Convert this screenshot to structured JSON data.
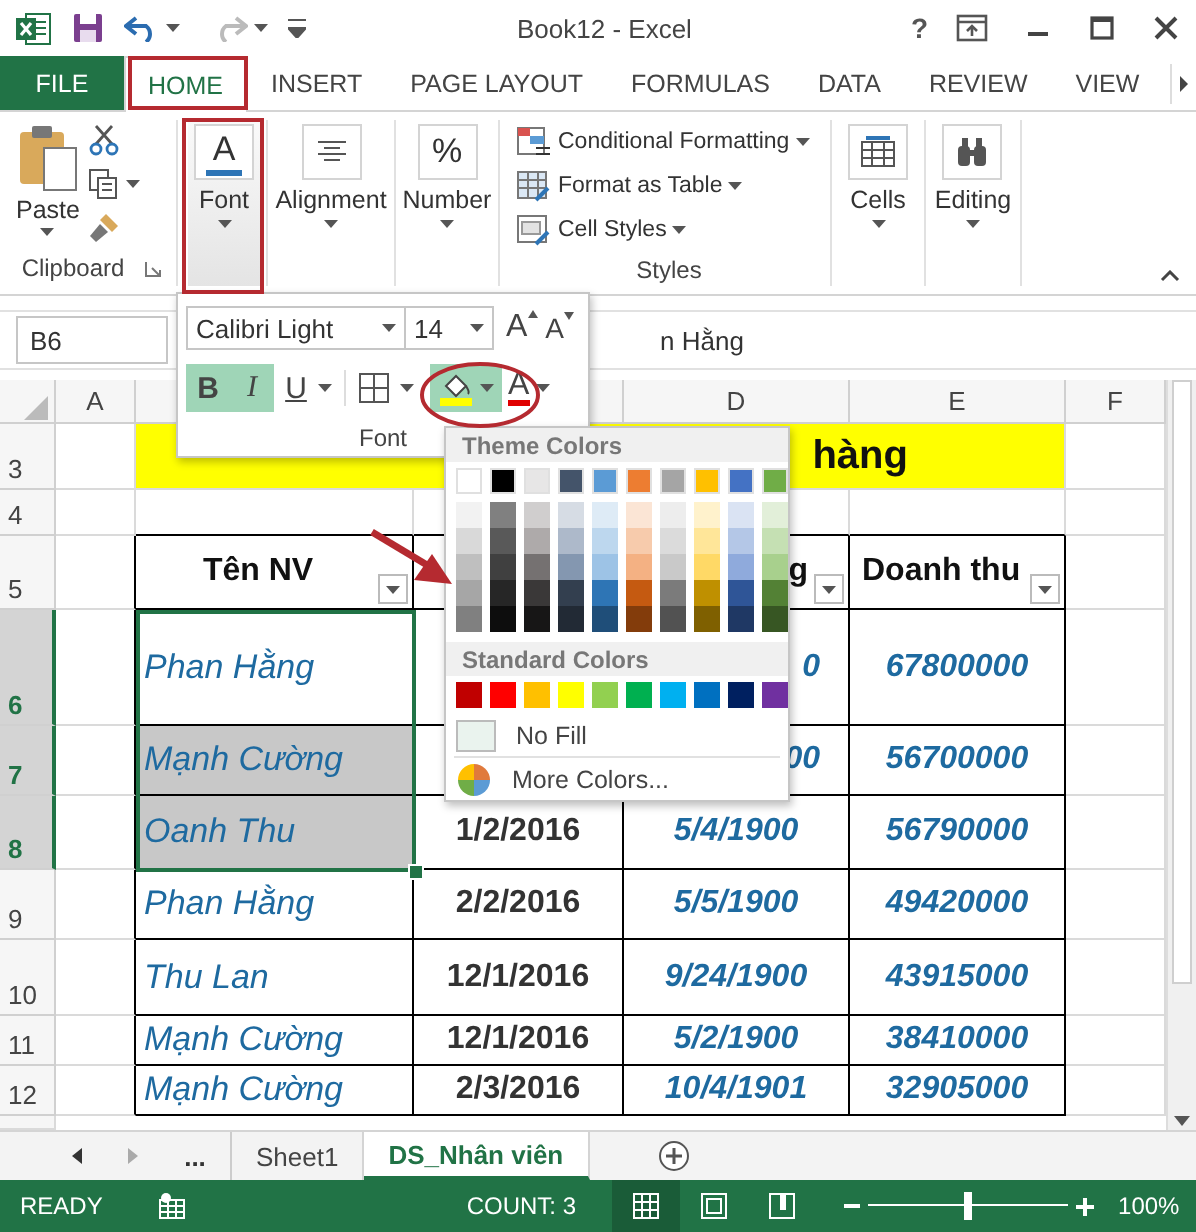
{
  "window": {
    "title": "Book12 - Excel",
    "help": "?"
  },
  "tabs": [
    {
      "label": "FILE",
      "kind": "file",
      "selected": false
    },
    {
      "label": "HOME",
      "kind": "tab",
      "selected": true
    },
    {
      "label": "INSERT",
      "kind": "tab",
      "selected": false
    },
    {
      "label": "PAGE LAYOUT",
      "kind": "tab",
      "selected": false
    },
    {
      "label": "FORMULAS",
      "kind": "tab",
      "selected": false
    },
    {
      "label": "DATA",
      "kind": "tab",
      "selected": false
    },
    {
      "label": "REVIEW",
      "kind": "tab",
      "selected": false
    },
    {
      "label": "VIEW",
      "kind": "tab",
      "selected": false
    }
  ],
  "ribbon": {
    "clipboard": {
      "paste": "Paste",
      "label": "Clipboard"
    },
    "collapsed_groups": [
      {
        "label": "Font",
        "kind": "font",
        "icon": "A",
        "pressed": true
      },
      {
        "label": "Alignment",
        "kind": "align",
        "pressed": false
      },
      {
        "label": "Number",
        "kind": "number",
        "icon": "%",
        "pressed": false
      }
    ],
    "styles": {
      "label": "Styles",
      "items": [
        {
          "label": "Conditional Formatting",
          "kind": "conditional"
        },
        {
          "label": "Format as Table",
          "kind": "table"
        },
        {
          "label": "Cell Styles",
          "kind": "styles"
        }
      ]
    },
    "end_groups": [
      {
        "label": "Cells",
        "kind": "cells"
      },
      {
        "label": "Editing",
        "kind": "editing"
      }
    ]
  },
  "formula_bar": {
    "name_box": "B6",
    "formula": "n Hằng"
  },
  "font_popup": {
    "font_name": "Calibri Light",
    "font_size": "14",
    "grow": "A",
    "shrink": "A",
    "buttons": [
      {
        "label": "B",
        "kind": "bold",
        "on": true
      },
      {
        "label": "I",
        "kind": "italic",
        "on": true
      },
      {
        "label": "U",
        "kind": "underline",
        "on": false
      }
    ],
    "fill_open": true,
    "font_color": "A",
    "label": "Font"
  },
  "color_menu": {
    "theme_title": "Theme Colors",
    "theme": [
      {
        "color": "#ffffff",
        "shades": [
          {
            "color": "#f2f2f2"
          },
          {
            "color": "#d9d9d9"
          },
          {
            "color": "#bfbfbf"
          },
          {
            "color": "#a6a6a6"
          },
          {
            "color": "#808080"
          }
        ]
      },
      {
        "color": "#000000",
        "shades": [
          {
            "color": "#808080"
          },
          {
            "color": "#595959"
          },
          {
            "color": "#404040"
          },
          {
            "color": "#262626"
          },
          {
            "color": "#0d0d0d"
          }
        ]
      },
      {
        "color": "#e7e6e6",
        "shades": [
          {
            "color": "#d0cece"
          },
          {
            "color": "#aeaaaa"
          },
          {
            "color": "#757171"
          },
          {
            "color": "#3a3838"
          },
          {
            "color": "#171616"
          }
        ]
      },
      {
        "color": "#44546a",
        "shades": [
          {
            "color": "#d6dce4"
          },
          {
            "color": "#adb9ca"
          },
          {
            "color": "#8497b0"
          },
          {
            "color": "#333f4f"
          },
          {
            "color": "#222a35"
          }
        ]
      },
      {
        "color": "#5b9bd5",
        "shades": [
          {
            "color": "#deebf6"
          },
          {
            "color": "#bdd7ee"
          },
          {
            "color": "#9dc3e6"
          },
          {
            "color": "#2e75b5"
          },
          {
            "color": "#1f4e79"
          }
        ]
      },
      {
        "color": "#ed7d31",
        "shades": [
          {
            "color": "#fbe5d5"
          },
          {
            "color": "#f7cbac"
          },
          {
            "color": "#f4b183"
          },
          {
            "color": "#c55a11"
          },
          {
            "color": "#833c0b"
          }
        ]
      },
      {
        "color": "#a5a5a5",
        "shades": [
          {
            "color": "#ededed"
          },
          {
            "color": "#dbdbdb"
          },
          {
            "color": "#c9c9c9"
          },
          {
            "color": "#7b7b7b"
          },
          {
            "color": "#525252"
          }
        ]
      },
      {
        "color": "#ffc000",
        "shades": [
          {
            "color": "#fff2cc"
          },
          {
            "color": "#ffe699"
          },
          {
            "color": "#ffd966"
          },
          {
            "color": "#bf9000"
          },
          {
            "color": "#7f6000"
          }
        ]
      },
      {
        "color": "#4472c4",
        "shades": [
          {
            "color": "#dae3f3"
          },
          {
            "color": "#b4c7e7"
          },
          {
            "color": "#8faadc"
          },
          {
            "color": "#2f5597"
          },
          {
            "color": "#1f3864"
          }
        ]
      },
      {
        "color": "#70ad47",
        "shades": [
          {
            "color": "#e2efd9"
          },
          {
            "color": "#c5e0b3"
          },
          {
            "color": "#a8d08d"
          },
          {
            "color": "#538135"
          },
          {
            "color": "#375623"
          }
        ]
      }
    ],
    "standard_title": "Standard Colors",
    "standard": [
      {
        "color": "#c00000"
      },
      {
        "color": "#ff0000"
      },
      {
        "color": "#ffc000"
      },
      {
        "color": "#ffff00"
      },
      {
        "color": "#92d050"
      },
      {
        "color": "#00b050"
      },
      {
        "color": "#00b0f0"
      },
      {
        "color": "#0070c0"
      },
      {
        "color": "#002060"
      },
      {
        "color": "#7030a0"
      }
    ],
    "no_fill": "No Fill",
    "more": "More Colors..."
  },
  "sheet": {
    "column_headers": [
      "A",
      "D",
      "E",
      "F"
    ],
    "row_headers": [
      {
        "label": "3",
        "selected": false
      },
      {
        "label": "4",
        "selected": false
      },
      {
        "label": "5",
        "selected": false
      },
      {
        "label": "6",
        "selected": true
      },
      {
        "label": "7",
        "selected": true
      },
      {
        "label": "8",
        "selected": true
      },
      {
        "label": "9",
        "selected": false
      },
      {
        "label": "10",
        "selected": false
      },
      {
        "label": "11",
        "selected": false
      },
      {
        "label": "12",
        "selected": false
      }
    ],
    "title": "hàng",
    "header_row": {
      "b": "Tên NV",
      "d": "g",
      "e": "Doanh thu"
    },
    "rows": [
      {
        "b": "Phan Hằng",
        "b_shaded": false,
        "d": "0",
        "e": "67800000"
      },
      {
        "b": "Mạnh Cường",
        "b_shaded": true,
        "d": "00",
        "e": "56700000"
      },
      {
        "b": "Oanh Thu",
        "b_shaded": true,
        "c": "1/2/2016",
        "d": "5/4/1900",
        "e": "56790000"
      },
      {
        "b": "Phan Hằng",
        "b_shaded": false,
        "c": "2/2/2016",
        "d": "5/5/1900",
        "e": "49420000"
      },
      {
        "b": "Thu Lan",
        "b_shaded": false,
        "c": "12/1/2016",
        "d": "9/24/1900",
        "e": "43915000"
      },
      {
        "b": "Mạnh Cường",
        "b_shaded": false,
        "c": "12/1/2016",
        "d": "5/2/1900",
        "e": "38410000"
      },
      {
        "b": "Mạnh Cường",
        "b_shaded": false,
        "c": "2/3/2016",
        "d": "10/4/1901",
        "e": "32905000"
      }
    ]
  },
  "sheet_tabs": {
    "more": "...",
    "tabs": [
      {
        "label": "Sheet1",
        "selected": false
      },
      {
        "label": "DS_Nhân viên",
        "selected": true
      }
    ]
  },
  "status_bar": {
    "ready": "READY",
    "count": "COUNT: 3",
    "views": [
      {
        "kind": "normal",
        "selected": true
      },
      {
        "kind": "layout",
        "selected": false
      },
      {
        "kind": "break",
        "selected": false
      }
    ],
    "zoom": {
      "level": 0.5
    },
    "zoom_label": "100%"
  }
}
